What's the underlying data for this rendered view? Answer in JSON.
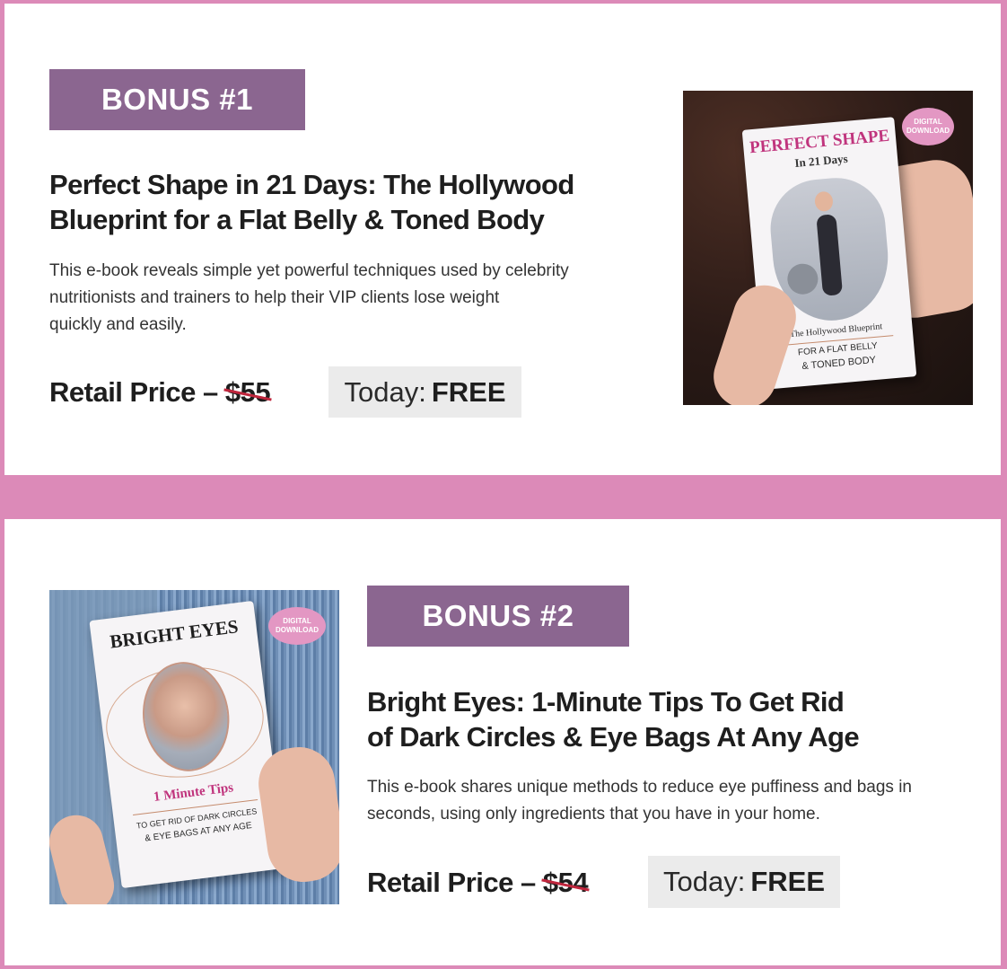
{
  "bonuses": [
    {
      "badge": "BONUS #1",
      "title_line1": "Perfect Shape in 21 Days: The Hollywood",
      "title_line2": "Blueprint for a Flat Belly & Toned Body",
      "desc_line1": "This e-book reveals simple yet powerful techniques used by celebrity",
      "desc_line2": "nutritionists and trainers to help their VIP clients lose weight",
      "desc_line3": "quickly and easily.",
      "retail_label": "Retail Price – ",
      "retail_price": "$55",
      "today_label": "Today:",
      "today_value": "FREE",
      "cover": {
        "title": "PERFECT SHAPE",
        "subtitle": "In 21 Days",
        "line1": "The Hollywood Blueprint",
        "line2": "FOR A FLAT BELLY",
        "line3": "& TONED BODY",
        "badge_line1": "DIGITAL",
        "badge_line2": "DOWNLOAD"
      }
    },
    {
      "badge": "BONUS #2",
      "title_line1": "Bright Eyes: 1-Minute Tips To Get Rid",
      "title_line2": "of Dark Circles & Eye Bags At Any Age",
      "desc_line1": "This e-book shares unique methods to reduce eye puffiness and bags in",
      "desc_line2": "seconds, using only ingredients that you have in your home.",
      "retail_label": "Retail Price – ",
      "retail_price": "$54",
      "today_label": "Today:",
      "today_value": "FREE",
      "cover": {
        "title": "BRIGHT EYES",
        "subtitle": "1 Minute Tips",
        "line1": "TO GET RID OF DARK CIRCLES",
        "line2": "& EYE BAGS AT ANY AGE",
        "badge_line1": "DIGITAL",
        "badge_line2": "DOWNLOAD"
      }
    }
  ],
  "colors": {
    "frame": "#dc8ab8",
    "badge": "#8b6690",
    "strike": "#c0263d",
    "today_bg": "#ebebeb"
  }
}
